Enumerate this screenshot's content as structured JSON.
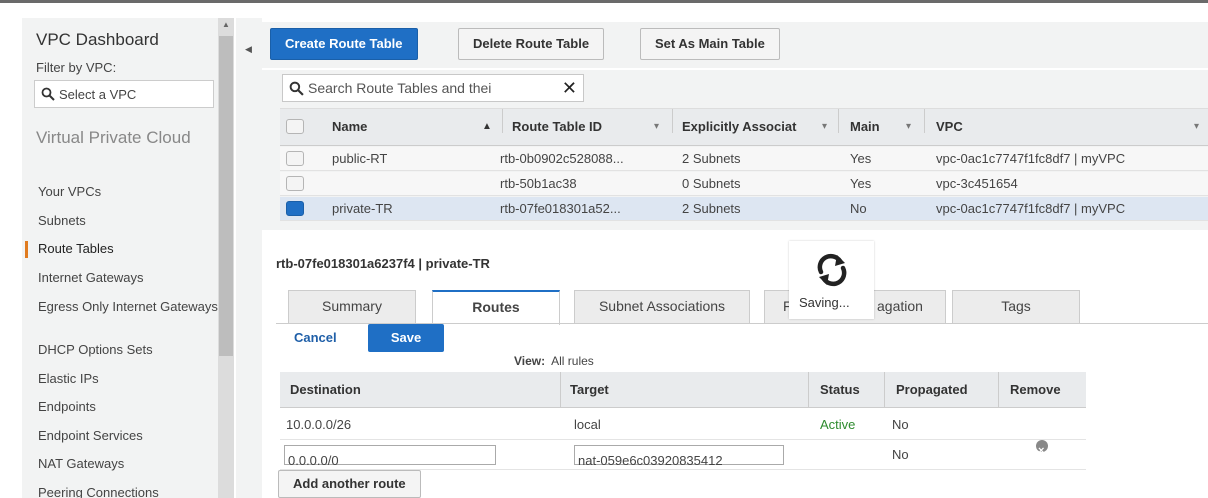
{
  "sidebar": {
    "title": "VPC Dashboard",
    "filter_label": "Filter by VPC:",
    "select_placeholder": "Select a VPC",
    "section": "Virtual Private Cloud",
    "items": [
      {
        "label": "Your VPCs"
      },
      {
        "label": "Subnets"
      },
      {
        "label": "Route Tables",
        "active": true
      },
      {
        "label": "Internet Gateways"
      },
      {
        "label": "Egress Only Internet Gateways"
      },
      {
        "label": "DHCP Options Sets"
      },
      {
        "label": "Elastic IPs"
      },
      {
        "label": "Endpoints"
      },
      {
        "label": "Endpoint Services"
      },
      {
        "label": "NAT Gateways"
      },
      {
        "label": "Peering Connections"
      }
    ]
  },
  "toolbar": {
    "create": "Create Route Table",
    "delete": "Delete Route Table",
    "set_main": "Set As Main Table"
  },
  "search": {
    "value": "Search Route Tables and thei"
  },
  "table": {
    "columns": [
      "Name",
      "Route Table ID",
      "Explicitly Associat",
      "Main",
      "VPC"
    ],
    "rows": [
      {
        "name": "public-RT",
        "id": "rtb-0b0902c528088...",
        "assoc": "2 Subnets",
        "main": "Yes",
        "vpc": "vpc-0ac1c7747f1fc8df7 | myVPC",
        "selected": false
      },
      {
        "name": "",
        "id": "rtb-50b1ac38",
        "assoc": "0 Subnets",
        "main": "Yes",
        "vpc": "vpc-3c451654",
        "selected": false
      },
      {
        "name": "private-TR",
        "id": "rtb-07fe018301a52...",
        "assoc": "2 Subnets",
        "main": "No",
        "vpc": "vpc-0ac1c7747f1fc8df7 | myVPC",
        "selected": true
      }
    ]
  },
  "details": {
    "title": "rtb-07fe018301a6237f4 | private-TR",
    "tabs": [
      "Summary",
      "Routes",
      "Subnet Associations",
      "F",
      "agation",
      "Tags"
    ],
    "cancel": "Cancel",
    "save": "Save",
    "view_label": "View:",
    "view_value": "All rules",
    "route_columns": [
      "Destination",
      "Target",
      "Status",
      "Propagated",
      "Remove"
    ],
    "routes": [
      {
        "destination": "10.0.0.0/26",
        "target": "local",
        "status": "Active",
        "propagated": "No"
      },
      {
        "destination": "0.0.0.0/0",
        "target": "nat-059e6c03920835412",
        "status": "",
        "propagated": "No"
      }
    ],
    "add_route": "Add another route"
  },
  "overlay": {
    "label": "Saving..."
  },
  "colors": {
    "primary": "#1f6fc5",
    "active_nav": "#e07b20",
    "status_active": "#2e8b2e"
  }
}
